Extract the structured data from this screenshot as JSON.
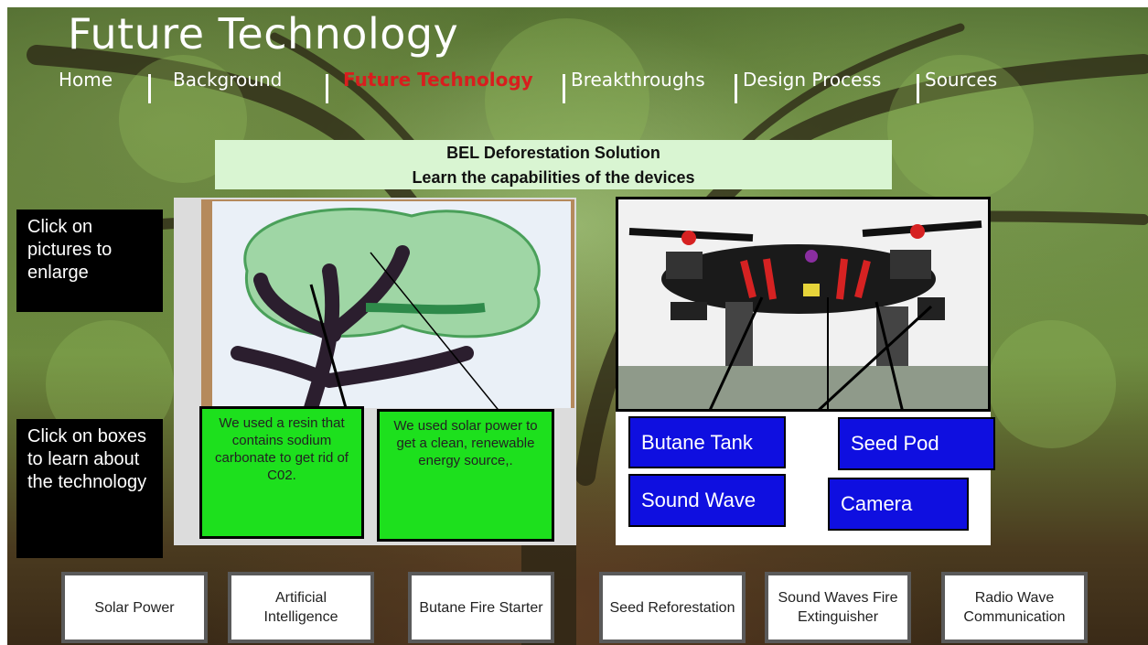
{
  "site": {
    "title": "Future Technology"
  },
  "nav": {
    "items": [
      {
        "label": "Home"
      },
      {
        "label": "Background"
      },
      {
        "label": "Future Technology"
      },
      {
        "label": "Breakthroughs"
      },
      {
        "label": "Design Process"
      },
      {
        "label": "Sources"
      }
    ]
  },
  "banner": {
    "line1": "BEL Deforestation Solution",
    "line2": "Learn the capabilities of the devices"
  },
  "side_notes": {
    "pictures": "Click on pictures to enlarge",
    "boxes": "Click on boxes to learn about the technology"
  },
  "tree_panel": {
    "box1": "We used a resin that contains sodium carbonate to get rid of C02.",
    "box2": "We used solar power to get a clean, renewable energy source,."
  },
  "drone_panel": {
    "labels": [
      "Butane Tank",
      "Seed Pod",
      "Sound Wave",
      "Camera"
    ]
  },
  "bottom_buttons": [
    {
      "label": "Solar Power"
    },
    {
      "label": "Artificial Intelligence"
    },
    {
      "label": "Butane Fire Starter"
    },
    {
      "label": "Seed Reforestation"
    },
    {
      "label": "Sound Waves Fire Extinguisher"
    },
    {
      "label": "Radio Wave Communication"
    }
  ],
  "colors": {
    "active_nav": "#d81e1e",
    "banner_bg": "#d9f5d2",
    "green_box": "#1de01d",
    "blue_box": "#0f0fe0"
  }
}
